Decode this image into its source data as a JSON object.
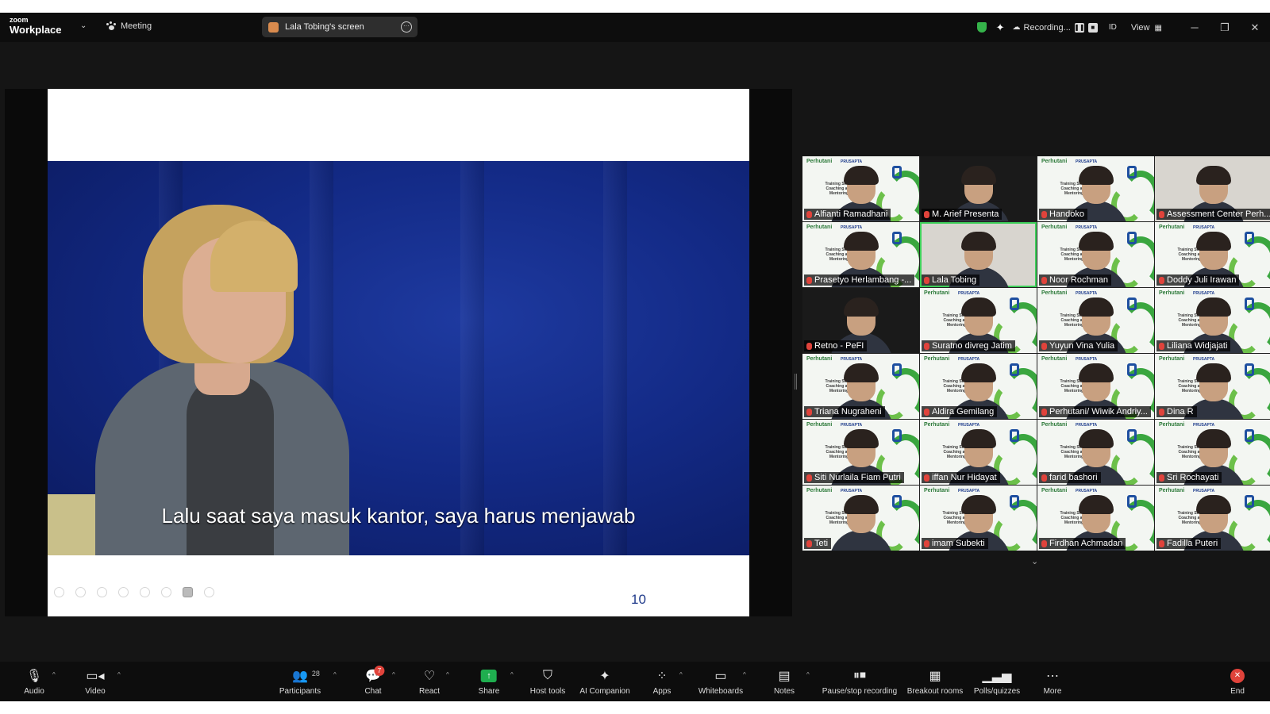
{
  "app": {
    "logo_top": "zoom",
    "logo_bottom": "Workplace",
    "meeting_label": "Meeting",
    "screen_share_label": "Lala Tobing's screen",
    "recording_label": "Recording...",
    "id_label": "ID",
    "view_label": "View"
  },
  "slide": {
    "subtitle": "Lalu saat saya masuk kantor, saya harus menjawab",
    "page_number": "10"
  },
  "participants": [
    {
      "name": "Alfianti Ramadhani",
      "bg": "banner"
    },
    {
      "name": "M. Arief Presenta",
      "bg": "dark"
    },
    {
      "name": "Handoko",
      "bg": "banner"
    },
    {
      "name": "Assessment Center Perh...",
      "bg": "office"
    },
    {
      "name": "Prasetyo Herlambang -...",
      "bg": "banner"
    },
    {
      "name": "Lala Tobing",
      "bg": "office",
      "active": true
    },
    {
      "name": "Noor Rochman",
      "bg": "banner"
    },
    {
      "name": "Doddy Juli Irawan",
      "bg": "banner"
    },
    {
      "name": "Retno - PeFI",
      "bg": "dark"
    },
    {
      "name": "Suratno divreg Jatim",
      "bg": "banner"
    },
    {
      "name": "Yuyun Vina Yulia",
      "bg": "banner"
    },
    {
      "name": "Liliana Widjajati",
      "bg": "banner"
    },
    {
      "name": "Triana Nugraheni",
      "bg": "banner"
    },
    {
      "name": "Aldira Gemilang",
      "bg": "banner"
    },
    {
      "name": "Perhutani/ Wiwik Andriy...",
      "bg": "banner"
    },
    {
      "name": "Dina R",
      "bg": "banner"
    },
    {
      "name": "Siti Nurlaila Fiam Putri",
      "bg": "banner"
    },
    {
      "name": "iffan Nur Hidayat",
      "bg": "banner"
    },
    {
      "name": "farid bashori",
      "bg": "banner"
    },
    {
      "name": "Sri Rochayati",
      "bg": "banner"
    },
    {
      "name": "Teti",
      "bg": "banner"
    },
    {
      "name": "imam Subekti",
      "bg": "banner"
    },
    {
      "name": "Firdhan Achmadan",
      "bg": "banner"
    },
    {
      "name": "Fadilla Puteri",
      "bg": "banner"
    }
  ],
  "tile_text": {
    "brand": "Perhutani",
    "brand2": "PRUSAPTA",
    "training": "Training Smart Coaching and Mentoring"
  },
  "toolbar": {
    "audio": "Audio",
    "video": "Video",
    "participants": "Participants",
    "participants_count": "28",
    "chat": "Chat",
    "chat_badge": "7",
    "react": "React",
    "share": "Share",
    "host_tools": "Host tools",
    "ai_companion": "AI Companion",
    "apps": "Apps",
    "whiteboards": "Whiteboards",
    "notes": "Notes",
    "pause_recording": "Pause/stop recording",
    "breakout_rooms": "Breakout rooms",
    "polls": "Polls/quizzes",
    "more": "More",
    "end": "End"
  },
  "colors": {
    "accent_green": "#1fae4f",
    "end_red": "#e0433b",
    "active_speaker": "#3ecf5a"
  }
}
